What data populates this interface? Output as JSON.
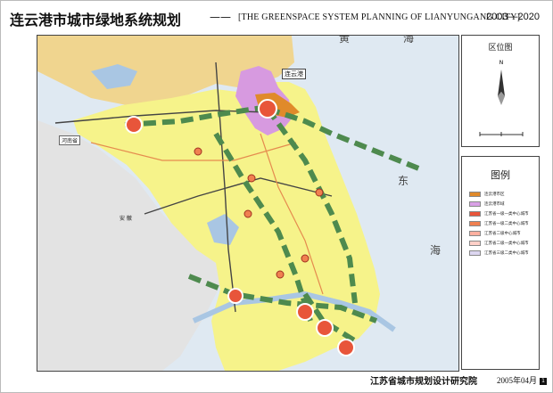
{
  "title": {
    "main": "连云港市城市绿地系统规划",
    "separator": "——",
    "english": "[THE GREENSPACE SYSTEM PLANNING OF LIANYUNGANG CITY]",
    "years": "2003—2020"
  },
  "map": {
    "sea_labels": [
      "黄",
      "海",
      "东",
      "海"
    ],
    "city_label": "连云港",
    "province_label": "河南省",
    "anhui_label": "安 徽",
    "colors": {
      "sea": "#dfe9f2",
      "jiangsu": "#f6f38a",
      "shandong": "#f0d58f",
      "anhui": "#e3e3e3",
      "lianyungang": "#d79ae0",
      "corridor": "#4e8a4e",
      "water": "#a9c6e3",
      "railway": "#444444",
      "highway": "#e58c4f"
    }
  },
  "side_panel": {
    "location_title": "区位图",
    "legend_title": "图例",
    "legend_items": [
      {
        "label": "连云港市区",
        "color": "#e08a2a"
      },
      {
        "label": "连云港市域",
        "color": "#d9a0e6"
      },
      {
        "label": "江苏省一级一类中心城市",
        "color": "#e8553a"
      },
      {
        "label": "江苏省一级二类中心城市",
        "color": "#f08050"
      },
      {
        "label": "江苏省二级中心城市",
        "color": "#ffb0a0"
      },
      {
        "label": "江苏省二级一类中心城市",
        "color": "#ffd0c8"
      },
      {
        "label": "江苏省三级二类中心城市",
        "color": "#dcd6f0"
      }
    ]
  },
  "footer": {
    "org": "江苏省城市规划设计研究院",
    "date": "2005年04月",
    "page": "1"
  }
}
